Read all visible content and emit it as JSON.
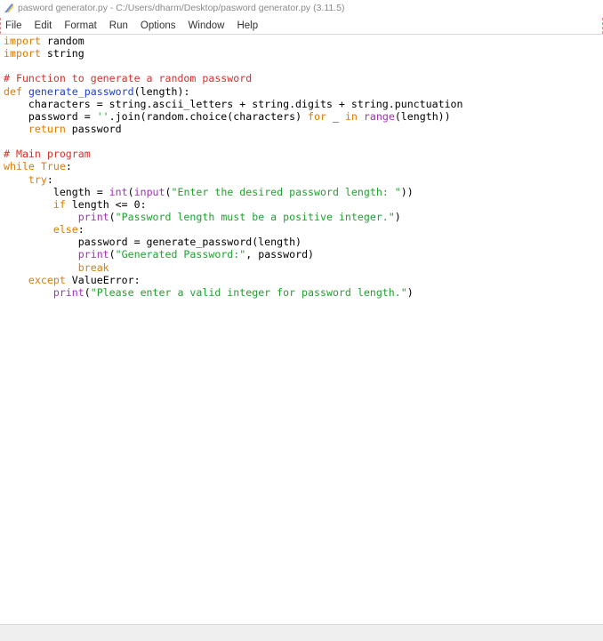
{
  "window": {
    "title": "pasword generator.py - C:/Users/dharm/Desktop/pasword generator.py (3.11.5)",
    "icon": "python-feather-icon"
  },
  "menu": {
    "items": [
      "File",
      "Edit",
      "Format",
      "Run",
      "Options",
      "Window",
      "Help"
    ]
  },
  "code": {
    "lines": [
      [
        [
          "kw",
          "import"
        ],
        [
          "",
          " random"
        ]
      ],
      [
        [
          "kw",
          "import"
        ],
        [
          "",
          " string"
        ]
      ],
      [],
      [
        [
          "com",
          "# Function to generate a random password"
        ]
      ],
      [
        [
          "kw",
          "def"
        ],
        [
          "",
          " "
        ],
        [
          "fn",
          "generate_password"
        ],
        [
          "",
          "(length):"
        ]
      ],
      [
        [
          "",
          "    characters = string.ascii_letters + string.digits + string.punctuation"
        ]
      ],
      [
        [
          "",
          "    password = "
        ],
        [
          "str",
          "''"
        ],
        [
          "",
          ".join(random.choice(characters) "
        ],
        [
          "kw",
          "for"
        ],
        [
          "",
          " _ "
        ],
        [
          "kw",
          "in"
        ],
        [
          "",
          " "
        ],
        [
          "bi",
          "range"
        ],
        [
          "",
          "(length))"
        ]
      ],
      [
        [
          "",
          "    "
        ],
        [
          "kw",
          "return"
        ],
        [
          "",
          " password"
        ]
      ],
      [],
      [
        [
          "com",
          "# Main program"
        ]
      ],
      [
        [
          "kw",
          "while"
        ],
        [
          "",
          " "
        ],
        [
          "kw",
          "True"
        ],
        [
          "",
          ":"
        ]
      ],
      [
        [
          "",
          "    "
        ],
        [
          "kw",
          "try"
        ],
        [
          "",
          ":"
        ]
      ],
      [
        [
          "",
          "        length = "
        ],
        [
          "bi",
          "int"
        ],
        [
          "",
          "("
        ],
        [
          "bi",
          "input"
        ],
        [
          "",
          "("
        ],
        [
          "str",
          "\"Enter the desired password length: \""
        ],
        [
          "",
          "))"
        ]
      ],
      [
        [
          "",
          "        "
        ],
        [
          "kw",
          "if"
        ],
        [
          "",
          " length <= 0:"
        ]
      ],
      [
        [
          "",
          "            "
        ],
        [
          "bi",
          "print"
        ],
        [
          "",
          "("
        ],
        [
          "str",
          "\"Password length must be a positive integer.\""
        ],
        [
          "",
          ")"
        ]
      ],
      [
        [
          "",
          "        "
        ],
        [
          "kw",
          "else"
        ],
        [
          "",
          ":"
        ]
      ],
      [
        [
          "",
          "            password = generate_password(length)"
        ]
      ],
      [
        [
          "",
          "            "
        ],
        [
          "bi",
          "print"
        ],
        [
          "",
          "("
        ],
        [
          "str",
          "\"Generated Password:\""
        ],
        [
          "",
          ", password)"
        ]
      ],
      [
        [
          "",
          "            "
        ],
        [
          "kw",
          "break"
        ]
      ],
      [
        [
          "",
          "    "
        ],
        [
          "kw",
          "except"
        ],
        [
          "",
          " ValueError:"
        ]
      ],
      [
        [
          "",
          "        "
        ],
        [
          "bi",
          "print"
        ],
        [
          "",
          "("
        ],
        [
          "str",
          "\"Please enter a valid integer for password length.\""
        ],
        [
          "",
          ")"
        ]
      ]
    ]
  },
  "colors": {
    "keyword": "#e07b00",
    "string": "#22a030",
    "comment": "#d4322c",
    "builtin": "#a030b8",
    "definition": "#1f3fd0"
  }
}
